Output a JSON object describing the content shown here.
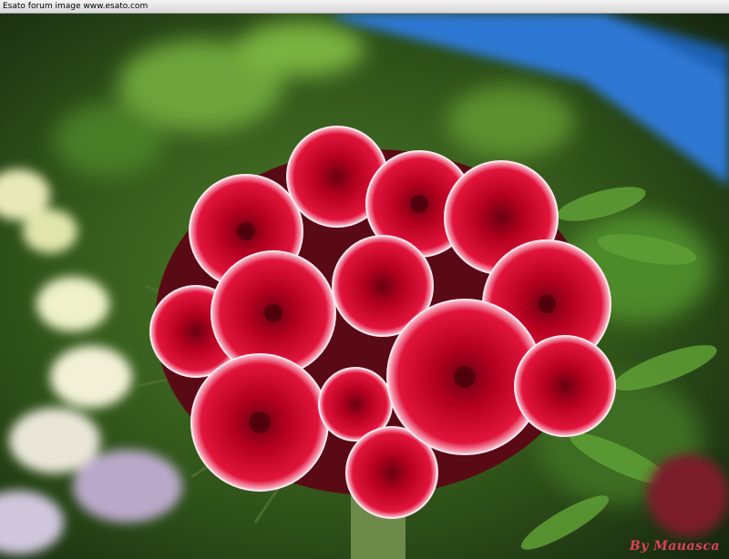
{
  "header": {
    "caption": "Esato forum image www.esato.com"
  },
  "photo": {
    "subject": "flower-cluster",
    "colors": {
      "petal_red": "#c8102e",
      "petal_rim": "#ffe6ee",
      "foliage": "#3f7a22",
      "sky_blue": "#3a7fd0"
    }
  },
  "signature": {
    "text": "By Mauasca"
  }
}
